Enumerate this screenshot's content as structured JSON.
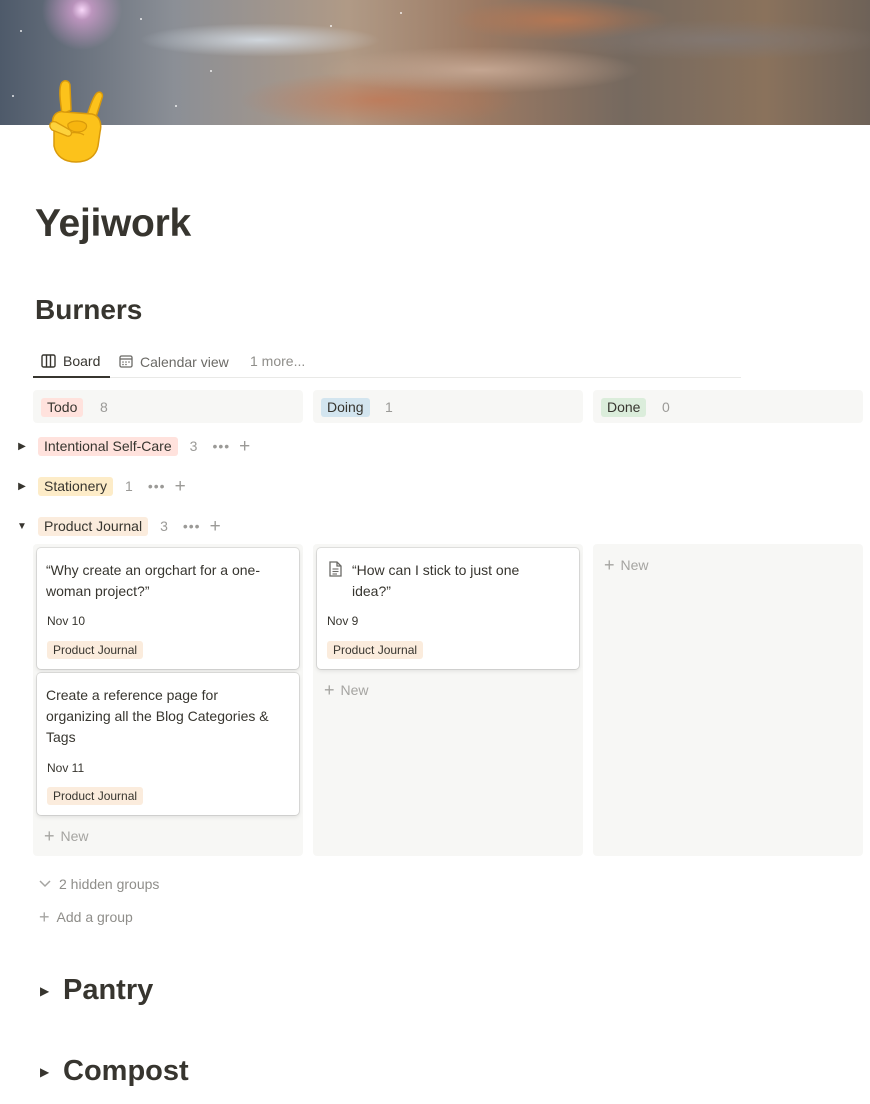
{
  "page": {
    "title": "Yejiwork",
    "icon": "sign-of-the-horns-emoji"
  },
  "database": {
    "title": "Burners",
    "views": [
      {
        "label": "Board",
        "icon": "board-icon",
        "active": true
      },
      {
        "label": "Calendar view",
        "icon": "calendar-icon",
        "active": false
      }
    ],
    "more_views": "1 more..."
  },
  "columns": [
    {
      "label": "Todo",
      "count": "8",
      "color": "#ffe2dd"
    },
    {
      "label": "Doing",
      "count": "1",
      "color": "#d3e5ef"
    },
    {
      "label": "Done",
      "count": "0",
      "color": "#dbeddb"
    }
  ],
  "groups": [
    {
      "label": "Intentional Self-Care",
      "count": "3",
      "color": "#ffe2dd",
      "expanded": false
    },
    {
      "label": "Stationery",
      "count": "1",
      "color": "#fdecc8",
      "expanded": false
    },
    {
      "label": "Product Journal",
      "count": "3",
      "color": "#fbecdd",
      "expanded": true
    }
  ],
  "cards": {
    "todo": [
      {
        "title_line1": "“Why create an orgchart for a one-",
        "title_line2": "woman project?”",
        "date": "Nov 10",
        "tag": "Product Journal"
      },
      {
        "title_line1": "Create a reference page for",
        "title_line2": "organizing all the Blog Categories &",
        "title_line3": "Tags",
        "date": "Nov 11",
        "tag": "Product Journal"
      }
    ],
    "doing": [
      {
        "title_line1": "“How can I stick to just one",
        "title_line2": "idea?”",
        "date": "Nov 9",
        "tag": "Product Journal",
        "icon": "page-icon"
      }
    ]
  },
  "new_label": "New",
  "hidden_groups": "2 hidden groups",
  "add_group": "Add a group",
  "toggles": [
    {
      "label": "Pantry"
    },
    {
      "label": "Compost"
    }
  ]
}
